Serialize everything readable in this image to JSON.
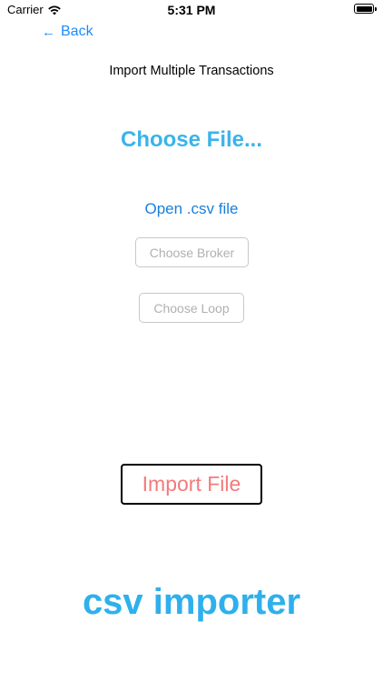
{
  "status_bar": {
    "carrier": "Carrier",
    "time": "5:31 PM"
  },
  "nav": {
    "back_arrow": "←",
    "back_label": "Back"
  },
  "page": {
    "title": "Import Multiple Transactions",
    "choose_file_label": "Choose File...",
    "open_csv_label": "Open .csv file",
    "choose_broker_label": "Choose Broker",
    "choose_loop_label": "Choose Loop",
    "import_file_label": "Import File"
  },
  "footer": {
    "brand": "csv importer"
  },
  "colors": {
    "link_blue": "#1a8cff",
    "accent_cyan": "#3ab4ea",
    "import_red": "#f27b7b",
    "disabled_gray": "#b0b0b0"
  }
}
